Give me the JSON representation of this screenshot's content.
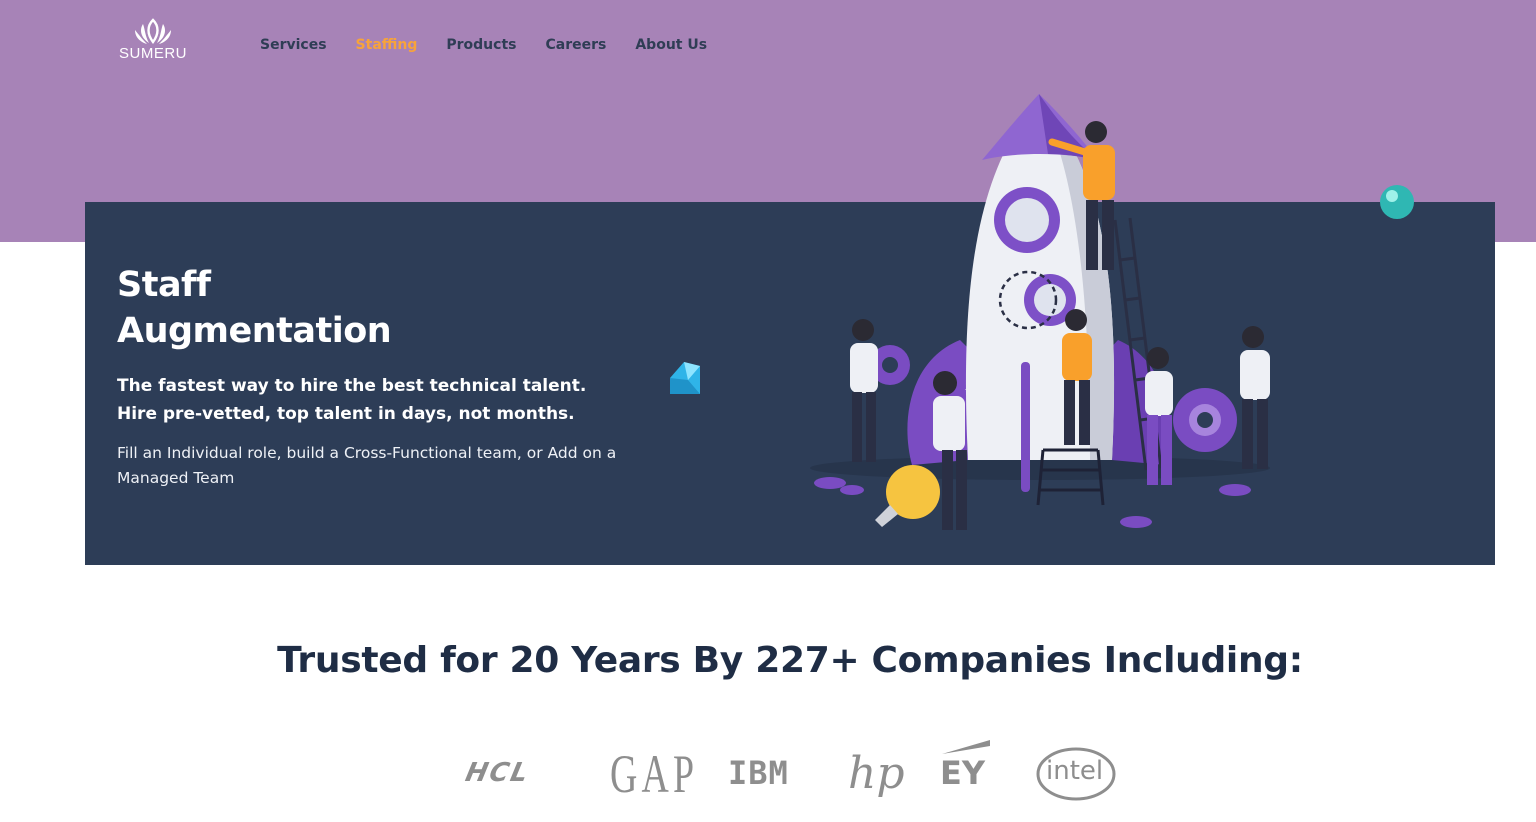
{
  "brand": {
    "name": "SUMERU"
  },
  "nav": {
    "items": [
      {
        "label": "Services",
        "active": false
      },
      {
        "label": "Staffing",
        "active": true
      },
      {
        "label": "Products",
        "active": false
      },
      {
        "label": "Careers",
        "active": false
      },
      {
        "label": "About Us",
        "active": false
      }
    ]
  },
  "hero": {
    "title_line1": "Staff",
    "title_line2": "Augmentation",
    "lead_line1": "The fastest way to hire the best technical talent.",
    "lead_line2": "Hire pre-vetted, top talent in days, not months.",
    "description": "Fill an Individual role, build a Cross-Functional team, or Add on a Managed Team"
  },
  "trusted": {
    "heading": "Trusted for 20 Years By 227+ Companies Including:"
  },
  "client_logos": [
    {
      "name": "HCL",
      "text": "HCL"
    },
    {
      "name": "GAP",
      "text": "GAP"
    },
    {
      "name": "IBM",
      "text": "IBM"
    },
    {
      "name": "HP",
      "text": "hp"
    },
    {
      "name": "EY",
      "text": "EY"
    },
    {
      "name": "Intel",
      "text": "intel"
    }
  ],
  "colors": {
    "top_band": "#a783b7",
    "hero_bg": "#2d3d57",
    "nav_text": "#2f3d55",
    "nav_active": "#f7a33b",
    "heading": "#1f2d45",
    "logo_gray": "#8e8e8e"
  }
}
